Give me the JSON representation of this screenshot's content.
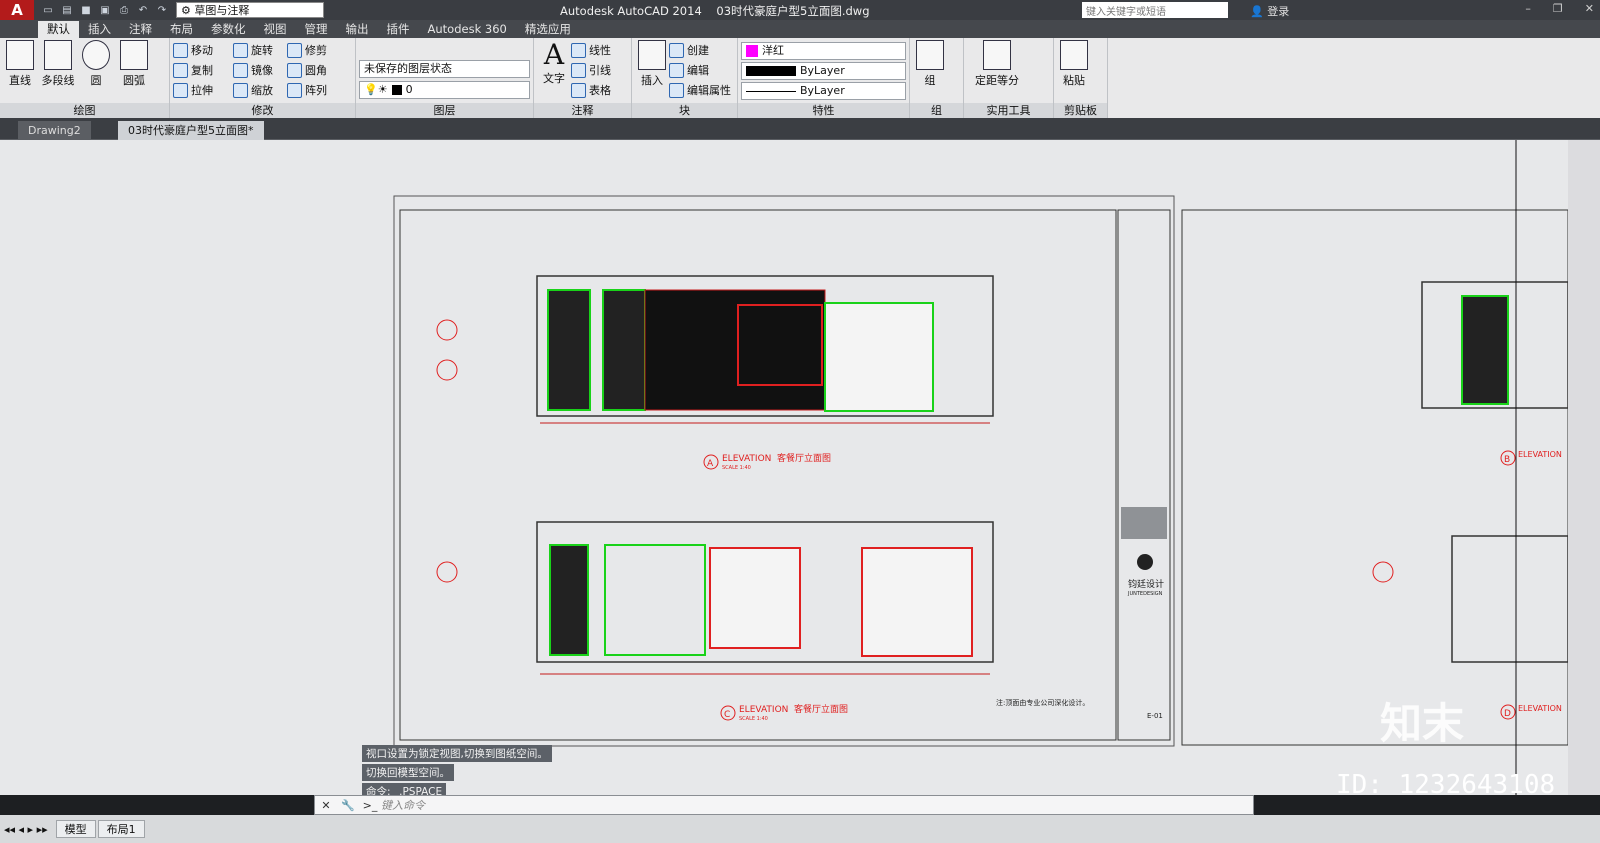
{
  "app": {
    "title": "Autodesk AutoCAD 2014",
    "file": "03时代豪庭户型5立面图.dwg",
    "logo": "A",
    "workspace": "草图与注释",
    "search_placeholder": "键入关键字或短语",
    "login": "登录"
  },
  "ribbon_tabs": [
    "默认",
    "插入",
    "注释",
    "布局",
    "参数化",
    "视图",
    "管理",
    "输出",
    "插件",
    "Autodesk 360",
    "精选应用"
  ],
  "ribbon": {
    "draw": {
      "label": "绘图",
      "line": "直线",
      "polyline": "多段线",
      "circle": "圆",
      "arc": "圆弧"
    },
    "modify": {
      "label": "修改",
      "move": "移动",
      "rotate": "旋转",
      "trim": "修剪",
      "copy": "复制",
      "mirror": "镜像",
      "fillet": "圆角",
      "stretch": "拉伸",
      "scale": "缩放",
      "array": "阵列"
    },
    "layer": {
      "label": "图层",
      "state": "未保存的图层状态",
      "current": "0"
    },
    "annotation": {
      "label": "注释",
      "text": "文字",
      "linear": "线性",
      "leader": "引线",
      "table": "表格"
    },
    "block": {
      "label": "块",
      "insert": "插入",
      "create": "创建",
      "edit": "编辑",
      "attr": "编辑属性"
    },
    "properties": {
      "label": "特性",
      "color": "洋红",
      "linetype": "ByLayer",
      "lineweight": "ByLayer"
    },
    "group": {
      "label": "组",
      "group": "组"
    },
    "utilities": {
      "label": "实用工具",
      "measure": "定距等分"
    },
    "clipboard": {
      "label": "剪贴板",
      "paste": "粘贴"
    }
  },
  "doc_tabs": [
    "Drawing2",
    "03时代豪庭户型5立面图*"
  ],
  "drawing": {
    "elev_a": {
      "tag": "A",
      "title": "ELEVATION",
      "name": "客餐厅立面图",
      "scale": "SCALE 1:40"
    },
    "elev_c": {
      "tag": "C",
      "title": "ELEVATION",
      "name": "客餐厅立面图",
      "scale": "SCALE 1:40"
    },
    "elev_b": {
      "tag": "B",
      "title": "ELEVATION"
    },
    "elev_d": {
      "tag": "D",
      "title": "ELEVATION"
    },
    "brand": "钧廷设计",
    "brand_en": "JUNTEDESIGN",
    "note": "注:顶面由专业公司深化设计。",
    "sheet": "E-01"
  },
  "command": {
    "history": [
      "视口设置为锁定视图,切换到图纸空间。",
      "切换回模型空间。",
      "命令: _.PSPACE"
    ],
    "placeholder": "键入命令"
  },
  "layouts": [
    "模型",
    "布局1"
  ],
  "watermark": {
    "text": "知末",
    "id": "ID: 1232643108"
  }
}
